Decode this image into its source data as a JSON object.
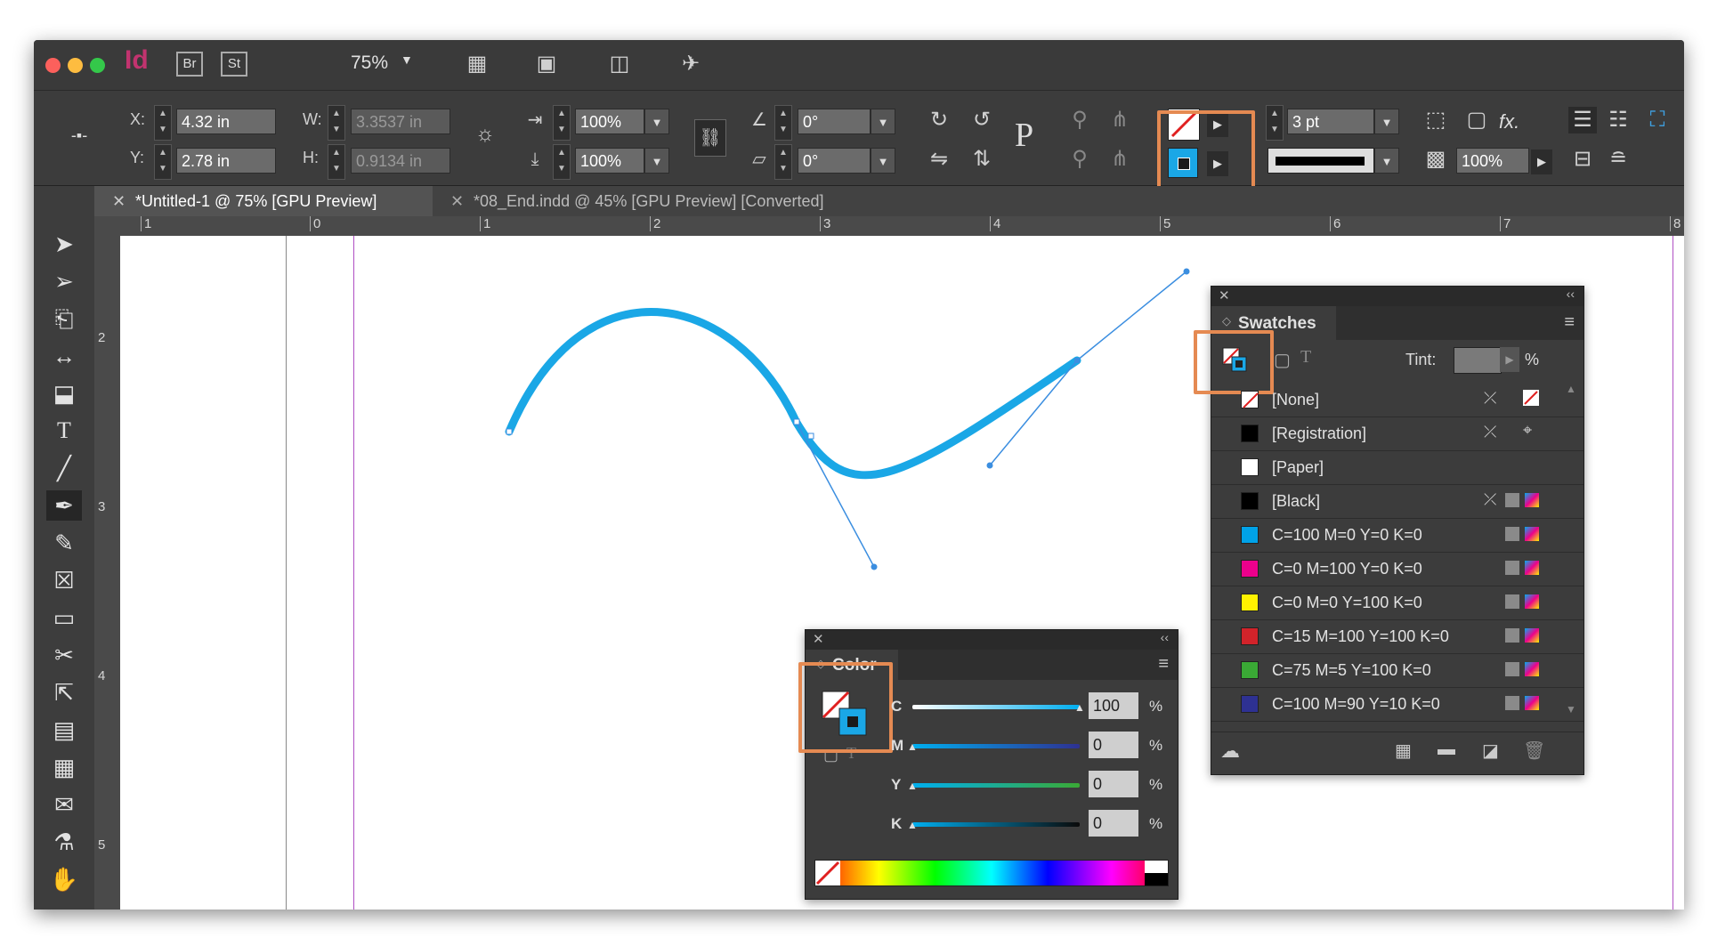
{
  "app": {
    "logo": "Id",
    "bridge_label": "Br",
    "stock_label": "St",
    "zoom": "75%"
  },
  "control": {
    "x_label": "X:",
    "x_value": "4.32 in",
    "y_label": "Y:",
    "y_value": "2.78 in",
    "w_label": "W:",
    "w_value": "3.3537 in",
    "h_label": "H:",
    "h_value": "0.9134 in",
    "scale_x": "100%",
    "scale_y": "100%",
    "rotate": "0°",
    "shear": "0°",
    "stroke_weight": "3 pt",
    "opacity": "100%"
  },
  "tabs": [
    {
      "label": "*Untitled-1 @ 75% [GPU Preview]",
      "active": true
    },
    {
      "label": "*08_End.indd @ 45% [GPU Preview] [Converted]",
      "active": false
    }
  ],
  "ruler_top": [
    "1",
    "0",
    "1",
    "2",
    "3",
    "4",
    "5",
    "6",
    "7",
    "8"
  ],
  "ruler_left": [
    "2",
    "3",
    "4",
    "5"
  ],
  "swatches": {
    "title": "Swatches",
    "tint_label": "Tint:",
    "tint_unit": "%",
    "items": [
      {
        "name": "[None]",
        "color": "none"
      },
      {
        "name": "[Registration]",
        "color": "#000000"
      },
      {
        "name": "[Paper]",
        "color": "#ffffff"
      },
      {
        "name": "[Black]",
        "color": "#000000"
      },
      {
        "name": "C=100 M=0 Y=0 K=0",
        "color": "#00a2e8"
      },
      {
        "name": "C=0 M=100 Y=0 K=0",
        "color": "#ec008c"
      },
      {
        "name": "C=0 M=0 Y=100 K=0",
        "color": "#fff200"
      },
      {
        "name": "C=15 M=100 Y=100 K=0",
        "color": "#d2232a"
      },
      {
        "name": "C=75 M=5 Y=100 K=0",
        "color": "#3aa935"
      },
      {
        "name": "C=100 M=90 Y=10 K=0",
        "color": "#2e3192"
      }
    ]
  },
  "color_panel": {
    "title": "Color",
    "channels": [
      {
        "label": "C",
        "value": "100",
        "unit": "%"
      },
      {
        "label": "M",
        "value": "0",
        "unit": "%"
      },
      {
        "label": "Y",
        "value": "0",
        "unit": "%"
      },
      {
        "label": "K",
        "value": "0",
        "unit": "%"
      }
    ]
  },
  "colors": {
    "stroke_cyan": "#1aa7e6",
    "highlight": "#e58a52",
    "guide_magenta": "#b04fc4"
  }
}
